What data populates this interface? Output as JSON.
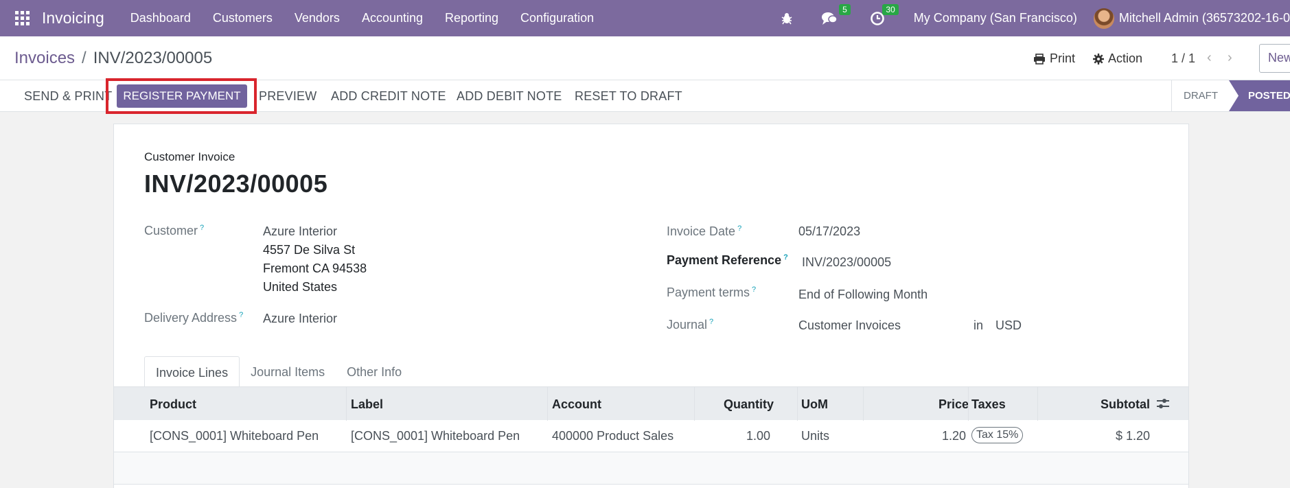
{
  "navbar": {
    "brand": "Invoicing",
    "menu": [
      "Dashboard",
      "Customers",
      "Vendors",
      "Accounting",
      "Reporting",
      "Configuration"
    ],
    "messages_count": "5",
    "activities_count": "30",
    "company": "My Company (San Francisco)",
    "user": "Mitchell Admin (36573202-16-0"
  },
  "control": {
    "breadcrumb_parent": "Invoices",
    "breadcrumb_current": "INV/2023/00005",
    "print_label": "Print",
    "action_label": "Action",
    "pager": "1 / 1",
    "new_label": "New"
  },
  "statusbar": {
    "send_print": "SEND & PRINT",
    "register_payment": "REGISTER PAYMENT",
    "preview": "PREVIEW",
    "add_credit_note": "ADD CREDIT NOTE",
    "add_debit_note": "ADD DEBIT NOTE",
    "reset_to_draft": "RESET TO DRAFT",
    "stage_draft": "DRAFT",
    "stage_posted": "POSTED",
    "highlight_color": "#d9252d"
  },
  "form": {
    "doc_type": "Customer Invoice",
    "doc_number": "INV/2023/00005",
    "customer_label": "Customer",
    "customer_name": "Azure Interior",
    "customer_street": "4557 De Silva St",
    "customer_city": "Fremont CA 94538",
    "customer_country": "United States",
    "delivery_label": "Delivery Address",
    "delivery_value": "Azure Interior",
    "invoice_date_label": "Invoice Date",
    "invoice_date": "05/17/2023",
    "payment_ref_label": "Payment Reference",
    "payment_ref": "INV/2023/00005",
    "payment_terms_label": "Payment terms",
    "payment_terms": "End of Following Month",
    "journal_label": "Journal",
    "journal": "Customer Invoices",
    "journal_in": "in",
    "currency": "USD",
    "help_mark": "?"
  },
  "tabs": [
    "Invoice Lines",
    "Journal Items",
    "Other Info"
  ],
  "lines": {
    "headers": {
      "product": "Product",
      "label": "Label",
      "account": "Account",
      "quantity": "Quantity",
      "uom": "UoM",
      "price": "Price",
      "taxes": "Taxes",
      "subtotal": "Subtotal"
    },
    "rows": [
      {
        "product": "[CONS_0001] Whiteboard Pen",
        "label": "[CONS_0001] Whiteboard Pen",
        "account": "400000 Product Sales",
        "quantity": "1.00",
        "uom": "Units",
        "price": "1.20",
        "taxes": "Tax 15%",
        "subtotal": "$ 1.20"
      }
    ]
  },
  "colors": {
    "navbar": "#7c6a9e",
    "primary": "#71639e"
  }
}
